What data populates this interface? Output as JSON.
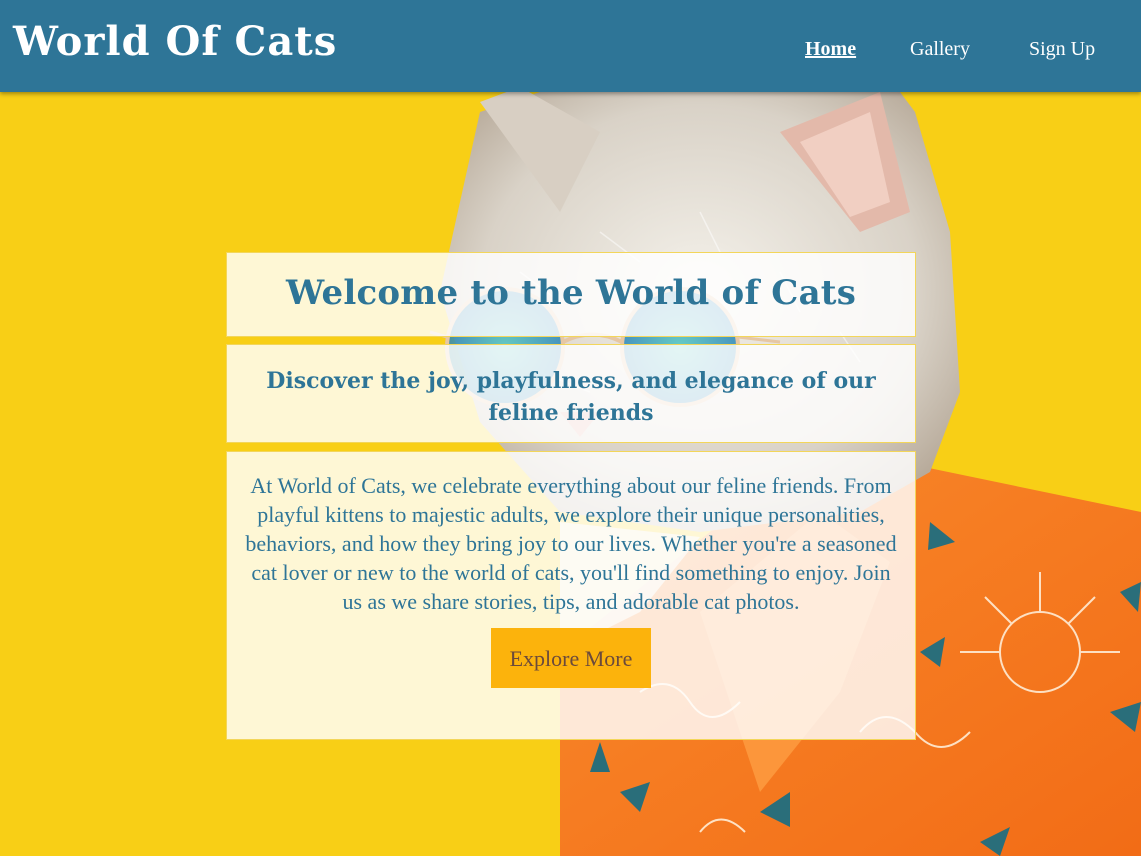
{
  "header": {
    "brand": "World Of Cats",
    "nav": {
      "home": "Home",
      "gallery": "Gallery",
      "signup": "Sign Up"
    }
  },
  "hero": {
    "title": "Welcome to the World of Cats",
    "subtitle": "Discover the joy, playfulness, and elegance of our feline friends",
    "body": "At World of Cats, we celebrate everything about our feline friends. From playful kittens to majestic adults, we explore their unique personalities, behaviors, and how they bring joy to our lives. Whether you're a seasoned cat lover or new to the world of cats, you'll find something to enjoy. Join us as we share stories, tips, and adorable cat photos.",
    "button": "Explore More"
  },
  "colors": {
    "navbar": "#2e7597",
    "background": "#f8cf16",
    "text_accent": "#2e7597",
    "button_bg": "#fcb30c",
    "button_text": "#6b4a3b"
  }
}
